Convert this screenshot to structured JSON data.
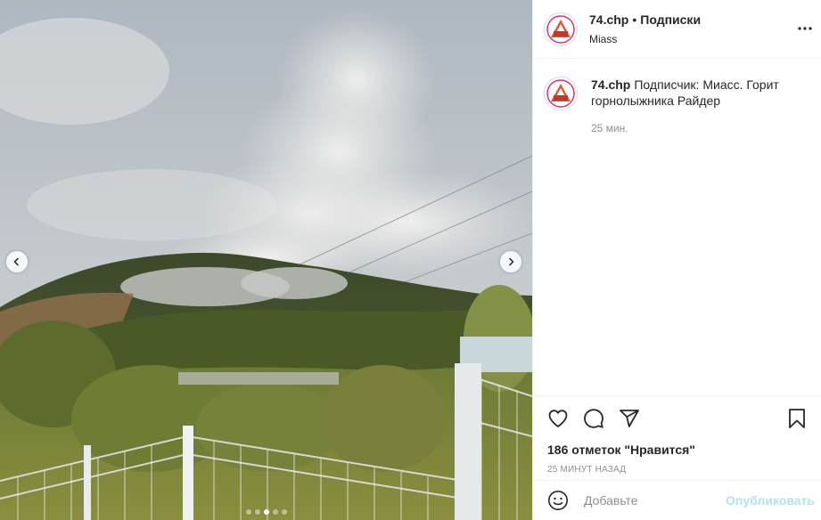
{
  "post": {
    "username": "74.chp",
    "bullet": "•",
    "follow_label": "Подписки",
    "location": "Miass",
    "more_icon": "more-horizontal-icon"
  },
  "caption": {
    "username": "74.chp",
    "text": "Подписчик: Миасс. Горит горнолыжника Райдер",
    "time": "25 мин."
  },
  "actions": {
    "like_icon": "heart-icon",
    "comment_icon": "comment-icon",
    "share_icon": "share-icon",
    "save_icon": "bookmark-icon",
    "likes": "186 отметок \"Нравится\"",
    "posted_ago": "25 МИНУТ НАЗАД"
  },
  "add_comment": {
    "placeholder": "Добавьте",
    "publish_label": "Опубликовать"
  },
  "carousel": {
    "slide_count": 5,
    "active_index": 2
  },
  "colors": {
    "text": "#262626",
    "muted": "#8e8e8e",
    "publish_disabled": "#b2dffc",
    "border": "#efefef"
  }
}
